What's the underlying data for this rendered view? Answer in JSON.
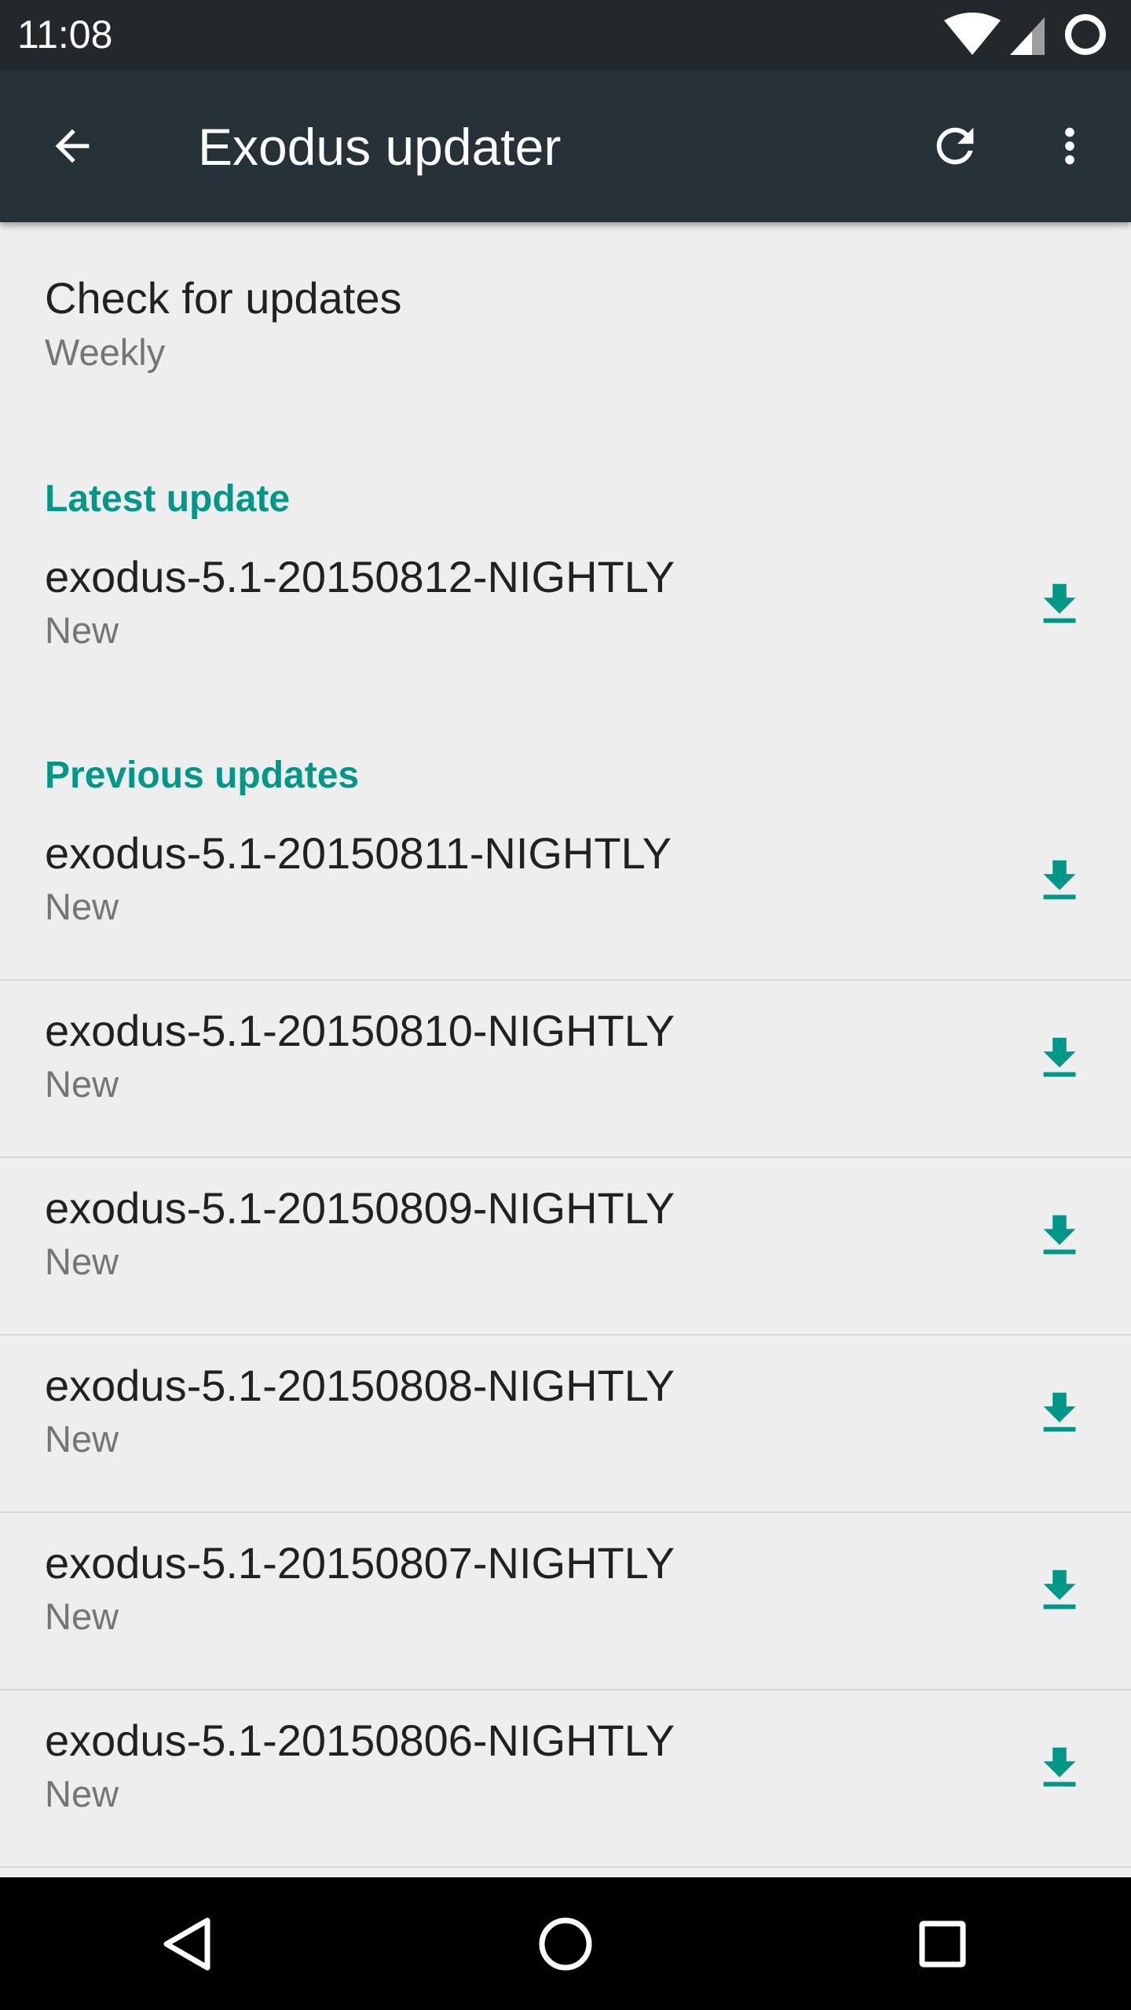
{
  "status_bar": {
    "time": "11:08"
  },
  "app_bar": {
    "title": "Exodus updater",
    "back_icon": "arrow-back-icon",
    "refresh_icon": "refresh-icon",
    "overflow_icon": "more-vert-icon"
  },
  "preferences": {
    "check_updates": {
      "title": "Check for updates",
      "summary": "Weekly"
    }
  },
  "latest_section": {
    "header": "Latest update",
    "item": {
      "title": "exodus-5.1-20150812-NIGHTLY",
      "summary": "New"
    }
  },
  "previous_section": {
    "header": "Previous updates",
    "items": [
      {
        "title": "exodus-5.1-20150811-NIGHTLY",
        "summary": "New"
      },
      {
        "title": "exodus-5.1-20150810-NIGHTLY",
        "summary": "New"
      },
      {
        "title": "exodus-5.1-20150809-NIGHTLY",
        "summary": "New"
      },
      {
        "title": "exodus-5.1-20150808-NIGHTLY",
        "summary": "New"
      },
      {
        "title": "exodus-5.1-20150807-NIGHTLY",
        "summary": "New"
      },
      {
        "title": "exodus-5.1-20150806-NIGHTLY",
        "summary": "New"
      }
    ]
  },
  "colors": {
    "accent": "#009688",
    "toolbar": "#263238",
    "status_bar": "#22282c",
    "background": "#eeeeee"
  }
}
